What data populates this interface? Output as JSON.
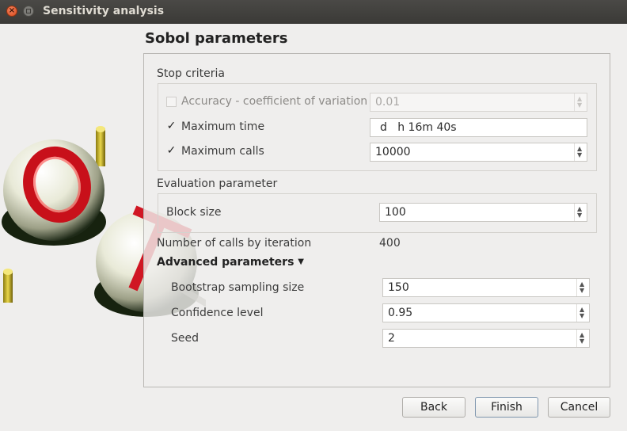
{
  "window": {
    "title": "Sensitivity analysis"
  },
  "page": {
    "heading": "Sobol parameters"
  },
  "stop_criteria": {
    "title": "Stop criteria",
    "accuracy": {
      "label": "Accuracy - coefficient of variation",
      "checked": false,
      "enabled": false,
      "value": "0.01"
    },
    "max_time": {
      "label": "Maximum time",
      "checked": true,
      "value": "d   h 16m 40s"
    },
    "max_calls": {
      "label": "Maximum calls",
      "checked": true,
      "value": "10000"
    }
  },
  "evaluation": {
    "title": "Evaluation parameter",
    "block_size_label": "Block size",
    "block_size_value": "100"
  },
  "calls_per_iteration": {
    "label": "Number of calls by iteration",
    "value": "400"
  },
  "advanced": {
    "title": "Advanced parameters",
    "bootstrap_label": "Bootstrap sampling size",
    "bootstrap_value": "150",
    "confidence_label": "Confidence level",
    "confidence_value": "0.95",
    "seed_label": "Seed",
    "seed_value": "2"
  },
  "buttons": {
    "back": "Back",
    "finish": "Finish",
    "cancel": "Cancel"
  },
  "icons": {
    "close": "close-icon",
    "minimize": "minimize-icon",
    "dropdown": "triangle-down-icon",
    "check": "checkmark-icon",
    "spin": "spin-arrows-icon"
  },
  "colors": {
    "titlebar": "#3b3a37",
    "close_button": "#e0552a",
    "default_button_border": "#7f96ae"
  }
}
